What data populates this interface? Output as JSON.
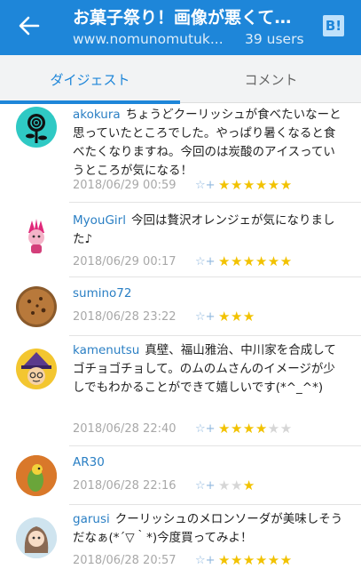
{
  "header": {
    "title": "お菓子祭り！画像が悪くて…",
    "url": "www.nomunomutuk...",
    "users": "39 users",
    "bookmark_button": "B!"
  },
  "tabs": [
    {
      "label": "ダイジェスト",
      "active": true
    },
    {
      "label": "コメント",
      "active": false
    }
  ],
  "comments": [
    {
      "user": "akokura",
      "text": "ちょうどクーリッシュが食べたいなーと思っていたところでした。やっぱり暑くなると食べたくなりますね。今回のは炭酸のアイスっていうところが気になる！",
      "date": "2018/06/29 00:59",
      "add_star": "☆+",
      "stars": 6,
      "gray_stars": 0,
      "avatar": "rose-avatar"
    },
    {
      "user": "MyouGirl",
      "text": "今回は贅沢オレンジェが気になりました♪",
      "date": "2018/06/29 00:17",
      "add_star": "☆+",
      "stars": 6,
      "gray_stars": 0,
      "avatar": "character-avatar"
    },
    {
      "user": "sumino72",
      "text": "",
      "date": "2018/06/28 23:22",
      "add_star": "☆+",
      "stars": 3,
      "gray_stars": 0,
      "avatar": "cookie-avatar"
    },
    {
      "user": "kamenutsu",
      "text": "真壁、福山雅治、中川家を合成してゴチョゴチョして。のムのムさんのイメージが少しでもわかることができて嬉しいです(*^_^*)",
      "date": "2018/06/28 22:40",
      "add_star": "☆+",
      "stars": 4,
      "gray_stars": 2,
      "avatar": "witch-avatar"
    },
    {
      "user": "AR30",
      "text": "",
      "date": "2018/06/28 22:16",
      "add_star": "☆+",
      "stars": 1,
      "gray_stars": 2,
      "gray_first": true,
      "avatar": "bird-avatar"
    },
    {
      "user": "garusi",
      "text": "クーリッシュのメロンソーダが美味しそうだなぁ(*´▽｀*)今度買ってみよ！",
      "date": "2018/06/28 20:57",
      "add_star": "☆+",
      "stars": 6,
      "gray_stars": 0,
      "avatar": "illustration-avatar"
    }
  ],
  "colors": {
    "appbar": "#1e86d9",
    "username": "#2a7fc4",
    "star": "#f2c200"
  }
}
